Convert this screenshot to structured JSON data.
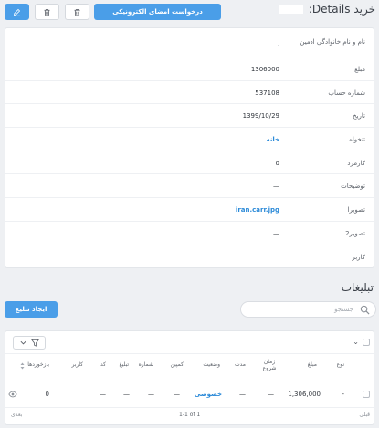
{
  "header": {
    "title_left": "خرید Details:",
    "sign_button": "درخواست امضای الکترونیکی"
  },
  "details": [
    {
      "label": "نام و نام خانوادگی ادمین",
      "value": ".",
      "link": false
    },
    {
      "label": "مبلغ",
      "value": "1306000",
      "link": false
    },
    {
      "label": "شماره حساب",
      "value": "537108",
      "link": false
    },
    {
      "label": "تاریخ",
      "value": "1399/10/29",
      "link": false
    },
    {
      "label": "تنخواه",
      "value": "خانه",
      "link": true
    },
    {
      "label": "کارمزد",
      "value": "0",
      "link": false
    },
    {
      "label": "توضیحات",
      "value": "—",
      "link": false
    },
    {
      "label": "تصویرا",
      "value": "iran.carr.jpg",
      "link": true
    },
    {
      "label": "تصویر2",
      "value": "—",
      "link": false
    },
    {
      "label": "کاربر",
      "value": "",
      "link": false
    }
  ],
  "section": {
    "title": "تبلیغات",
    "create_button": "ایجاد تبلیغ",
    "search_placeholder": "جستجو"
  },
  "table": {
    "headers": [
      "نوع",
      "مبلغ",
      "زمان شروع",
      "مدت",
      "وضعیت",
      "کمپین",
      "شماره",
      "تبلیغ",
      "کد",
      "کاربر",
      "بازخوردها"
    ],
    "row": [
      "-",
      "1,306,000",
      "—",
      "—",
      "خصوصی",
      "—",
      "—",
      "—",
      "—",
      "",
      "0"
    ],
    "pager": {
      "prev": "قبلی",
      "info": "1-1 of 1",
      "next": "بعدی"
    }
  }
}
